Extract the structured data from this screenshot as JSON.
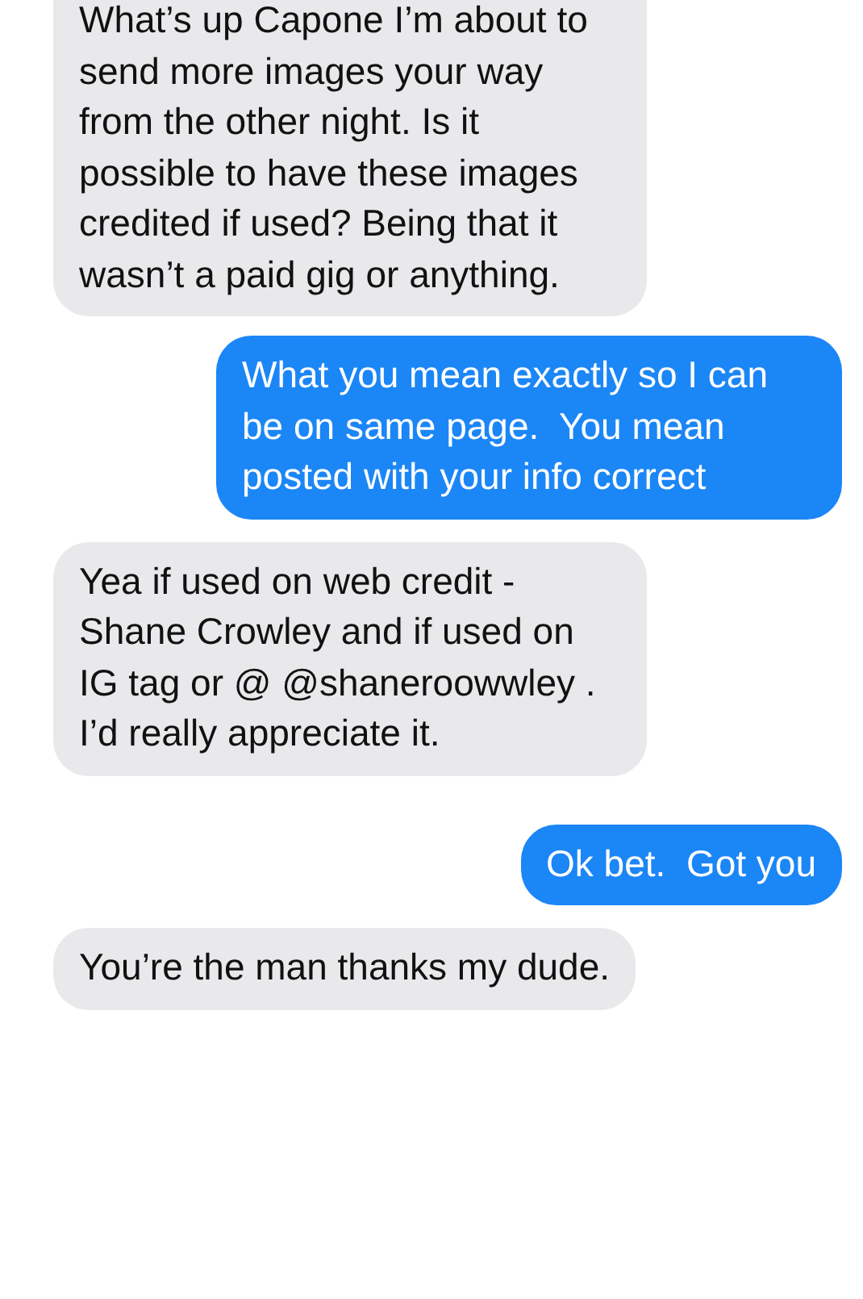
{
  "messages": [
    {
      "kind": "incoming",
      "text": "What’s up Capone I’m about to send more images your way from the other night. Is it possible to have these images credited if used? Being that it wasn’t a paid gig or anything."
    },
    {
      "kind": "outgoing",
      "text": "What you mean exactly so I can be on same page.  You mean posted with your info correct"
    },
    {
      "kind": "incoming",
      "text": "Yea if used on web credit - Shane Crowley and if used on IG tag or @ @shaneroowwley . I’d really appreciate it."
    },
    {
      "kind": "outgoing",
      "text": "Ok bet.  Got you"
    },
    {
      "kind": "incoming",
      "text": "You’re the man thanks my dude."
    }
  ]
}
